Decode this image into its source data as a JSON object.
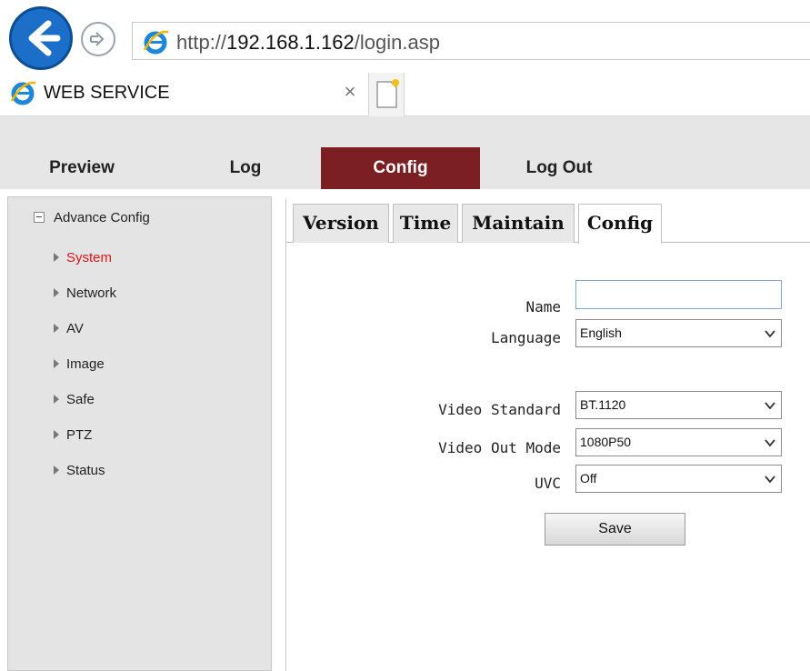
{
  "browser": {
    "url_prefix": "http://",
    "url_host": "192.168.1.162",
    "url_path": "/login.asp",
    "tab_title": "WEB SERVICE",
    "tab_close": "×"
  },
  "nav": {
    "items": [
      {
        "label": "Preview"
      },
      {
        "label": "Log"
      },
      {
        "label": "Config",
        "active": true
      },
      {
        "label": "Log Out"
      }
    ]
  },
  "sidebar": {
    "root_label": "Advance Config",
    "items": [
      {
        "label": "System",
        "active": true
      },
      {
        "label": "Network"
      },
      {
        "label": "AV"
      },
      {
        "label": "Image"
      },
      {
        "label": "Safe"
      },
      {
        "label": "PTZ"
      },
      {
        "label": "Status"
      }
    ]
  },
  "tabs": [
    {
      "label": "Version"
    },
    {
      "label": "Time"
    },
    {
      "label": "Maintain"
    },
    {
      "label": "Config",
      "active": true
    }
  ],
  "form": {
    "name_label": "Name",
    "name_value": "",
    "language_label": "Language",
    "language_value": "English",
    "video_standard_label": "Video Standard",
    "video_standard_value": "BT.1120",
    "video_out_mode_label": "Video Out Mode",
    "video_out_mode_value": "1080P50",
    "uvc_label": "UVC",
    "uvc_value": "Off",
    "save_label": "Save"
  },
  "colors": {
    "active_nav_bg": "#7b1f22",
    "active_sidebar_text": "#e0141a",
    "browser_back_blue": "#1b6fc8"
  },
  "icons": {
    "back": "back-arrow-icon",
    "forward": "forward-arrow-icon",
    "browser": "internet-explorer-icon",
    "new_tab": "new-tab-icon",
    "tree_collapse": "minus-box-icon",
    "menu_arrow": "triangle-right-icon",
    "dropdown": "chevron-down-icon"
  }
}
